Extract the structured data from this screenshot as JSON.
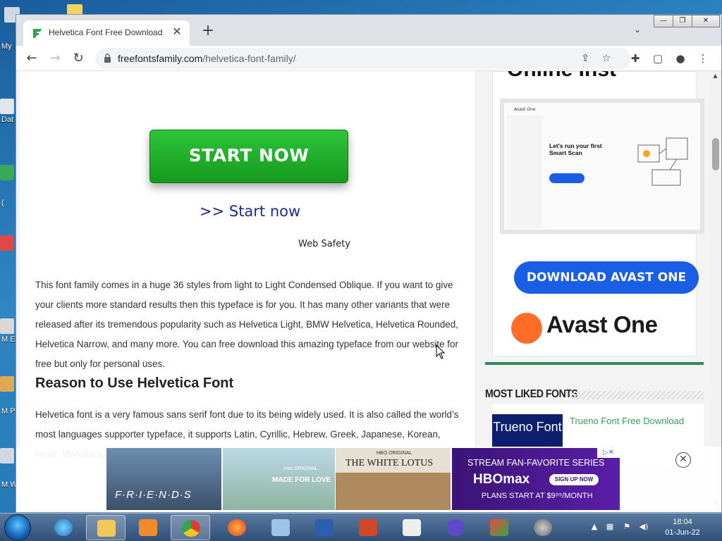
{
  "desktop": {
    "icon_labels": [
      "My",
      "Dat",
      "(",
      "M\nE",
      "M\nPo",
      "M\nW"
    ]
  },
  "browser": {
    "tab_title": "Helvetica Font Free Download",
    "url_host": "freefontsfamily.com",
    "url_path": "/helvetica-font-family/",
    "window_controls": {
      "minimize": "—",
      "restore": "❐",
      "close": "✕"
    }
  },
  "content": {
    "start_button": "START NOW",
    "start_link": ">> Start now",
    "web_safety": "Web Safety",
    "paragraph1": "This font family comes in a huge 36 styles from light to Light Condensed Oblique. If you want to give your clients more standard results then this typeface is for you. It has many other variants that were released after its tremendous popularity such as Helvetica Light, BMW Helvetica, Helvetica Rounded, Helvetica Narrow, and many more. You can free download this amazing typeface from our website for free but only for personal uses.",
    "heading": "Reason to Use Helvetica Font",
    "paragraph2": "Helvetica font is a very famous sans serif font due to its being widely used. It is also called the world’s most languages supporter typeface, it supports Latin, Cyrillic, Hebrew, Greek, Japanese, Korean, Hindi, Manufacturing like on federal"
  },
  "sidebar": {
    "ad_heading": "Online Inst",
    "ad_shot_title": "Let's run your first Smart Scan",
    "ad_shot_brand": "Avast One",
    "download_button": "DOWNLOAD AVAST ONE",
    "avast_brand": "Avast One",
    "most_liked_title": "MOST LIKED FONTS",
    "font_card": {
      "thumb_text": "Trueno Font",
      "link": "Trueno Font Free Download"
    }
  },
  "ad_banner": {
    "friends": "F·R·I·E·N·D·S",
    "made_for_love_small": "max ORIGINAL",
    "made_for_love": "MADE FOR LOVE",
    "white_lotus_small": "HBO ORIGINAL",
    "white_lotus": "THE WHITE LOTUS",
    "hbomax_line1": "STREAM FAN-FAVORITE SERIES",
    "hbomax_logo": "HBOmax",
    "hbomax_cta": "SIGN UP NOW",
    "hbomax_price": "PLANS START AT $9⁹⁹/MONTH",
    "close": "✕"
  },
  "taskbar": {
    "time": "18:04",
    "date": "01-Jun-22"
  }
}
